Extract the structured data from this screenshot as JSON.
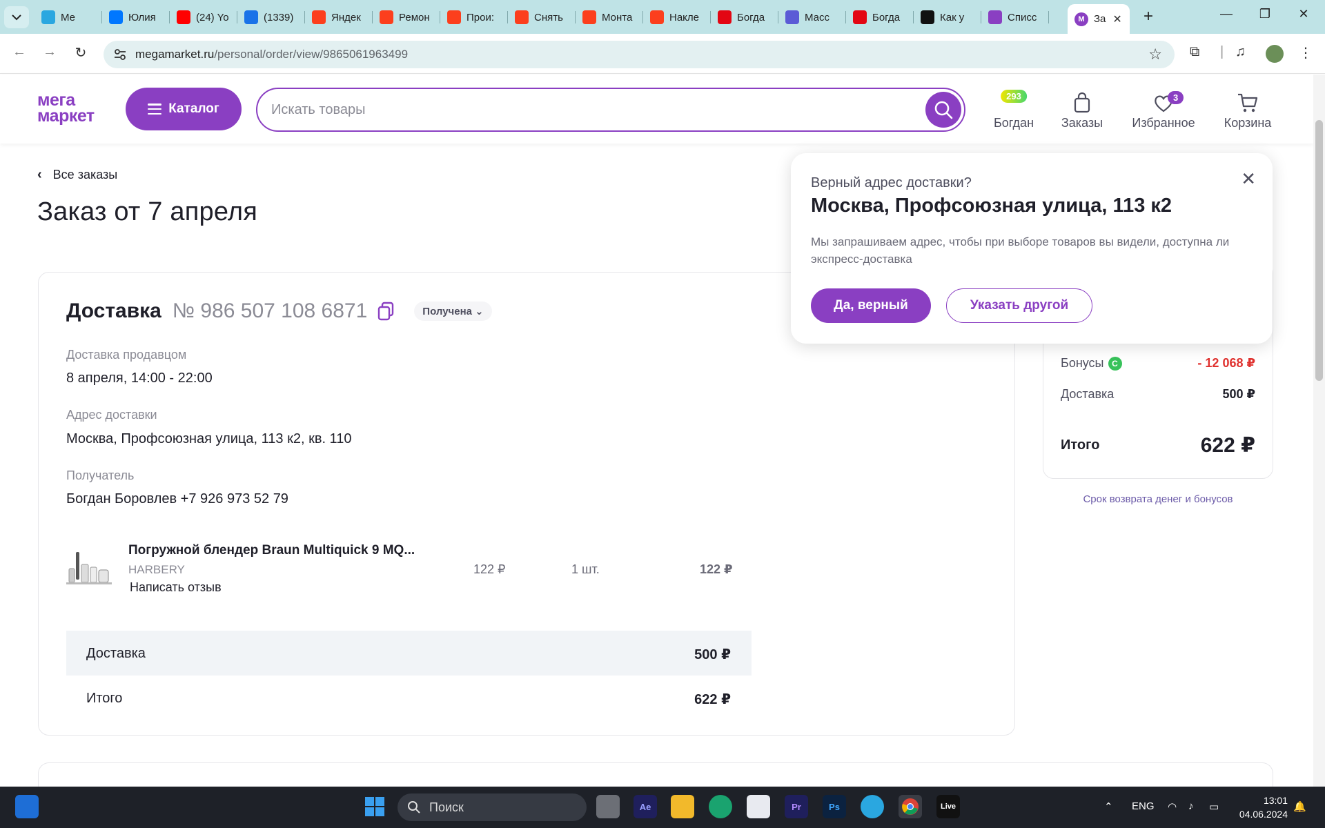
{
  "browser": {
    "tabs": [
      {
        "label": "Ме",
        "color": "#2aa7e0"
      },
      {
        "label": "Юлия",
        "color": "#0077ff"
      },
      {
        "label": "(24) Yo",
        "color": "#ff0000"
      },
      {
        "label": "(1339)",
        "color": "#1a73e8"
      },
      {
        "label": "Яндек",
        "color": "#fc3f1d"
      },
      {
        "label": "Ремон",
        "color": "#fc3f1d"
      },
      {
        "label": "Прои:",
        "color": "#fc3f1d"
      },
      {
        "label": "Снять",
        "color": "#fc3f1d"
      },
      {
        "label": "Монта",
        "color": "#fc3f1d"
      },
      {
        "label": "Накле",
        "color": "#fc3f1d"
      },
      {
        "label": "Богда",
        "color": "#e30613"
      },
      {
        "label": "Масс",
        "color": "#5b5bd6"
      },
      {
        "label": "Богда",
        "color": "#e30613"
      },
      {
        "label": "Как у",
        "color": "#111111"
      },
      {
        "label": "Списс",
        "color": "#8a3fc2"
      }
    ],
    "active_tab": {
      "label": "За",
      "color": "#8a3fc2"
    },
    "url_domain": "megamarket.ru",
    "url_path": "/personal/order/view/9865061963499"
  },
  "header": {
    "logo_line1": "мега",
    "logo_line2": "маркет",
    "catalog_label": "Каталог",
    "search_placeholder": "Искать товары",
    "profile_label": "Богдан",
    "bonus_badge": "293",
    "orders_label": "Заказы",
    "favorites_label": "Избранное",
    "favorites_count": "3",
    "cart_label": "Корзина"
  },
  "page": {
    "back_label": "Все заказы",
    "title": "Заказ от 7 апреля"
  },
  "delivery": {
    "title": "Доставка",
    "number": "№ 986 507 108 6871",
    "status": "Получена",
    "method_label": "Доставка продавцом",
    "method_value": "8 апреля, 14:00 - 22:00",
    "address_label": "Адрес доставки",
    "address_value": "Москва, Профсоюзная улица, 113 к2, кв. 110",
    "recipient_label": "Получатель",
    "recipient_value": "Богдан Боровлев +7 926 973 52 79"
  },
  "product": {
    "name": "Погружной блендер Braun Multiquick 9 MQ...",
    "brand": "HARBERY",
    "review_link": "Написать отзыв",
    "price": "122 ₽",
    "qty": "1 шт.",
    "sum": "122 ₽"
  },
  "order_totals": {
    "delivery_label": "Доставка",
    "delivery_value": "500 ₽",
    "total_label": "Итого",
    "total_value": "622 ₽"
  },
  "summary": {
    "bonus_label": "Бонусы",
    "bonus_value": "- 12 068 ₽",
    "delivery_label": "Доставка",
    "delivery_value": "500 ₽",
    "total_label": "Итого",
    "total_value": "622 ₽",
    "refund_link": "Срок возврата денег и бонусов"
  },
  "popup": {
    "question": "Верный адрес доставки?",
    "address": "Москва, Профсоюзная улица, 113 к2",
    "description": "Мы запрашиваем адрес, чтобы при выборе товаров вы видели, доступна ли экспресс-доставка",
    "yes_label": "Да, верный",
    "other_label": "Указать другой"
  },
  "taskbar": {
    "search_label": "Поиск",
    "lang": "ENG",
    "time": "13:01",
    "date": "04.06.2024"
  },
  "colors": {
    "brand": "#8a3fc2",
    "bonus_red": "#e0322f"
  }
}
